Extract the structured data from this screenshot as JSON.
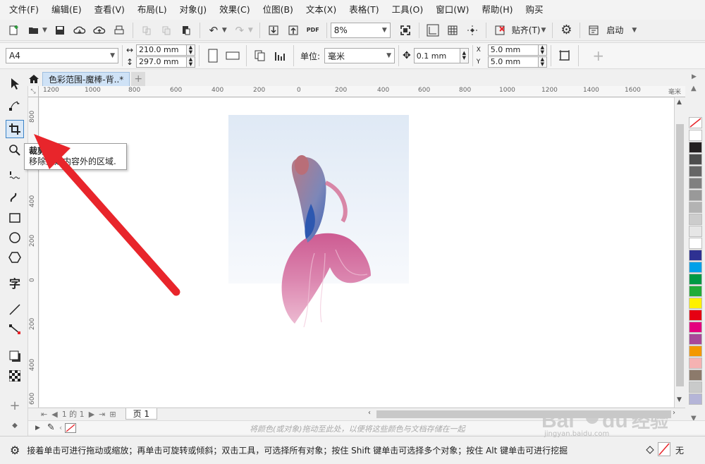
{
  "menu": [
    "文件(F)",
    "编辑(E)",
    "查看(V)",
    "布局(L)",
    "对象(J)",
    "效果(C)",
    "位图(B)",
    "文本(X)",
    "表格(T)",
    "工具(O)",
    "窗口(W)",
    "帮助(H)",
    "购买"
  ],
  "toolbar1": {
    "pdf_label": "PDF",
    "zoom": "8%",
    "snap_label": "贴齐(T)",
    "launch_label": "启动"
  },
  "toolbar2": {
    "paper": "A4",
    "width": "210.0 mm",
    "height": "297.0 mm",
    "unit_label": "单位:",
    "unit": "毫米",
    "nudge": "0.1 mm",
    "dup_x": "5.0 mm",
    "dup_y": "5.0 mm",
    "dup_x_label": "X",
    "dup_y_label": "Y"
  },
  "document": {
    "tab_title": "色彩范围-魔棒-背..*"
  },
  "rulers": {
    "horizontal": [
      "1200",
      "1000",
      "800",
      "600",
      "400",
      "200",
      "0",
      "200",
      "400",
      "600",
      "800",
      "1000",
      "1200",
      "1400",
      "1600"
    ],
    "vertical": [
      "800",
      "600",
      "400",
      "200",
      "0",
      "200",
      "400",
      "600"
    ],
    "unit_label": "毫米"
  },
  "tooltip": {
    "title": "裁剪工具",
    "description": "移除选定内容外的区域."
  },
  "pagebar": {
    "counter": "1 的 1",
    "page_tab": "页 1"
  },
  "colorbar": {
    "hint": "将颜色(或对象)拖动至此处，以便将这些颜色与文档存储在一起"
  },
  "status": {
    "message": "接着单击可进行拖动或缩放；再单击可旋转或倾斜；双击工具，可选择所有对象；按住 Shift 键单击可选择多个对象；按住 Alt 键单击可进行挖掘",
    "fill_label": "无"
  },
  "palette": [
    "#ffffff",
    "#231f20",
    "#4d4d4d",
    "#666666",
    "#808080",
    "#999999",
    "#b3b3b3",
    "#cccccc",
    "#e6e6e6",
    "#ffffff",
    "#2e3192",
    "#00a0e9",
    "#009944",
    "#22ac38",
    "#fff100",
    "#e60012",
    "#e4007f",
    "#a84799",
    "#f39800",
    "#f5b2b2",
    "#8c7a6b",
    "#c9caca",
    "#b5b5d8"
  ],
  "watermark": {
    "brand": "Bai du 经验",
    "url": "jingyan.baidu.com"
  },
  "colors": {
    "accent": "#3c84c8",
    "arrow": "#e8252b",
    "tab_bg": "#cfe2f6"
  }
}
